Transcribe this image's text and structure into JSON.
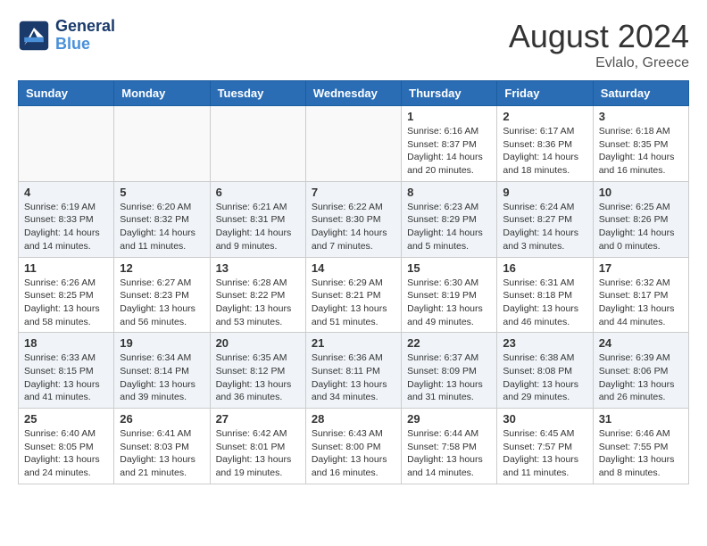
{
  "header": {
    "logo_line1": "General",
    "logo_line2": "Blue",
    "month_year": "August 2024",
    "location": "Evlalo, Greece"
  },
  "weekdays": [
    "Sunday",
    "Monday",
    "Tuesday",
    "Wednesday",
    "Thursday",
    "Friday",
    "Saturday"
  ],
  "weeks": [
    [
      {
        "day": "",
        "info": ""
      },
      {
        "day": "",
        "info": ""
      },
      {
        "day": "",
        "info": ""
      },
      {
        "day": "",
        "info": ""
      },
      {
        "day": "1",
        "info": "Sunrise: 6:16 AM\nSunset: 8:37 PM\nDaylight: 14 hours\nand 20 minutes."
      },
      {
        "day": "2",
        "info": "Sunrise: 6:17 AM\nSunset: 8:36 PM\nDaylight: 14 hours\nand 18 minutes."
      },
      {
        "day": "3",
        "info": "Sunrise: 6:18 AM\nSunset: 8:35 PM\nDaylight: 14 hours\nand 16 minutes."
      }
    ],
    [
      {
        "day": "4",
        "info": "Sunrise: 6:19 AM\nSunset: 8:33 PM\nDaylight: 14 hours\nand 14 minutes."
      },
      {
        "day": "5",
        "info": "Sunrise: 6:20 AM\nSunset: 8:32 PM\nDaylight: 14 hours\nand 11 minutes."
      },
      {
        "day": "6",
        "info": "Sunrise: 6:21 AM\nSunset: 8:31 PM\nDaylight: 14 hours\nand 9 minutes."
      },
      {
        "day": "7",
        "info": "Sunrise: 6:22 AM\nSunset: 8:30 PM\nDaylight: 14 hours\nand 7 minutes."
      },
      {
        "day": "8",
        "info": "Sunrise: 6:23 AM\nSunset: 8:29 PM\nDaylight: 14 hours\nand 5 minutes."
      },
      {
        "day": "9",
        "info": "Sunrise: 6:24 AM\nSunset: 8:27 PM\nDaylight: 14 hours\nand 3 minutes."
      },
      {
        "day": "10",
        "info": "Sunrise: 6:25 AM\nSunset: 8:26 PM\nDaylight: 14 hours\nand 0 minutes."
      }
    ],
    [
      {
        "day": "11",
        "info": "Sunrise: 6:26 AM\nSunset: 8:25 PM\nDaylight: 13 hours\nand 58 minutes."
      },
      {
        "day": "12",
        "info": "Sunrise: 6:27 AM\nSunset: 8:23 PM\nDaylight: 13 hours\nand 56 minutes."
      },
      {
        "day": "13",
        "info": "Sunrise: 6:28 AM\nSunset: 8:22 PM\nDaylight: 13 hours\nand 53 minutes."
      },
      {
        "day": "14",
        "info": "Sunrise: 6:29 AM\nSunset: 8:21 PM\nDaylight: 13 hours\nand 51 minutes."
      },
      {
        "day": "15",
        "info": "Sunrise: 6:30 AM\nSunset: 8:19 PM\nDaylight: 13 hours\nand 49 minutes."
      },
      {
        "day": "16",
        "info": "Sunrise: 6:31 AM\nSunset: 8:18 PM\nDaylight: 13 hours\nand 46 minutes."
      },
      {
        "day": "17",
        "info": "Sunrise: 6:32 AM\nSunset: 8:17 PM\nDaylight: 13 hours\nand 44 minutes."
      }
    ],
    [
      {
        "day": "18",
        "info": "Sunrise: 6:33 AM\nSunset: 8:15 PM\nDaylight: 13 hours\nand 41 minutes."
      },
      {
        "day": "19",
        "info": "Sunrise: 6:34 AM\nSunset: 8:14 PM\nDaylight: 13 hours\nand 39 minutes."
      },
      {
        "day": "20",
        "info": "Sunrise: 6:35 AM\nSunset: 8:12 PM\nDaylight: 13 hours\nand 36 minutes."
      },
      {
        "day": "21",
        "info": "Sunrise: 6:36 AM\nSunset: 8:11 PM\nDaylight: 13 hours\nand 34 minutes."
      },
      {
        "day": "22",
        "info": "Sunrise: 6:37 AM\nSunset: 8:09 PM\nDaylight: 13 hours\nand 31 minutes."
      },
      {
        "day": "23",
        "info": "Sunrise: 6:38 AM\nSunset: 8:08 PM\nDaylight: 13 hours\nand 29 minutes."
      },
      {
        "day": "24",
        "info": "Sunrise: 6:39 AM\nSunset: 8:06 PM\nDaylight: 13 hours\nand 26 minutes."
      }
    ],
    [
      {
        "day": "25",
        "info": "Sunrise: 6:40 AM\nSunset: 8:05 PM\nDaylight: 13 hours\nand 24 minutes."
      },
      {
        "day": "26",
        "info": "Sunrise: 6:41 AM\nSunset: 8:03 PM\nDaylight: 13 hours\nand 21 minutes."
      },
      {
        "day": "27",
        "info": "Sunrise: 6:42 AM\nSunset: 8:01 PM\nDaylight: 13 hours\nand 19 minutes."
      },
      {
        "day": "28",
        "info": "Sunrise: 6:43 AM\nSunset: 8:00 PM\nDaylight: 13 hours\nand 16 minutes."
      },
      {
        "day": "29",
        "info": "Sunrise: 6:44 AM\nSunset: 7:58 PM\nDaylight: 13 hours\nand 14 minutes."
      },
      {
        "day": "30",
        "info": "Sunrise: 6:45 AM\nSunset: 7:57 PM\nDaylight: 13 hours\nand 11 minutes."
      },
      {
        "day": "31",
        "info": "Sunrise: 6:46 AM\nSunset: 7:55 PM\nDaylight: 13 hours\nand 8 minutes."
      }
    ]
  ]
}
